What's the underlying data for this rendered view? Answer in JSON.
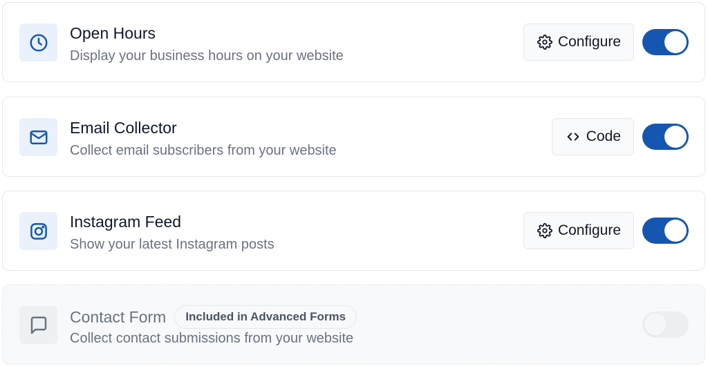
{
  "colors": {
    "accent": "#1557b0",
    "icon_tile_bg": "#eaf1fb",
    "disabled_bg": "#f7f9fb",
    "text_primary": "#111827",
    "text_secondary": "#6b7280"
  },
  "integrations": [
    {
      "title": "Open Hours",
      "description": "Display your business hours on your website",
      "icon": "clock-icon",
      "action": {
        "label": "Configure",
        "icon": "gear-icon"
      },
      "enabled": true
    },
    {
      "title": "Email Collector",
      "description": "Collect email subscribers from your website",
      "icon": "mail-icon",
      "action": {
        "label": "Code",
        "icon": "code-icon"
      },
      "enabled": true
    },
    {
      "title": "Instagram Feed",
      "description": "Show your latest Instagram posts",
      "icon": "instagram-icon",
      "action": {
        "label": "Configure",
        "icon": "gear-icon"
      },
      "enabled": true
    },
    {
      "title": "Contact Form",
      "badge": "Included in Advanced Forms",
      "description": "Collect contact submissions from your website",
      "icon": "message-icon",
      "enabled": false
    }
  ]
}
